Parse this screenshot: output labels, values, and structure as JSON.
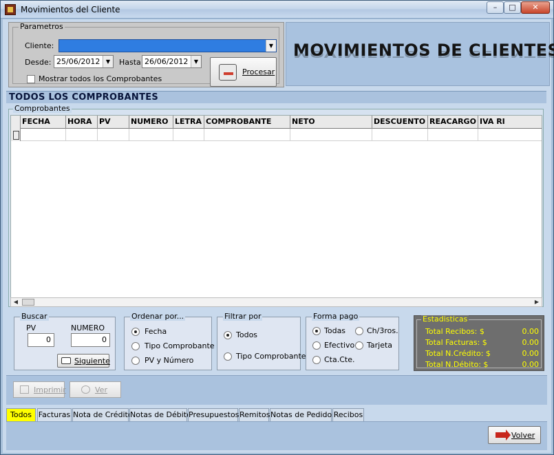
{
  "window": {
    "title": "Movimientos del Cliente",
    "buttons": {
      "minimize": "–",
      "maximize": "□",
      "close": "✕"
    }
  },
  "params": {
    "legend": "Parametros",
    "cliente_label": "Cliente:",
    "cliente_value": "",
    "desde_label": "Desde:",
    "desde_value": "25/06/2012",
    "hasta_label": "Hasta:",
    "hasta_value": "26/06/2012",
    "mostrar_todos_label": "Mostrar todos los Comprobantes",
    "mostrar_todos_checked": false,
    "procesar_label": "Procesar"
  },
  "banner": {
    "title": "MOVIMIENTOS DE CLIENTES"
  },
  "section": {
    "title": "TODOS LOS COMPROBANTES"
  },
  "comprobantes": {
    "legend": "Comprobantes",
    "columns": [
      "FECHA",
      "HORA",
      "PV",
      "NUMERO",
      "LETRA",
      "COMPROBANTE",
      "NETO",
      "DESCUENTO",
      "REACARGO",
      "IVA RI"
    ]
  },
  "buscar": {
    "legend": "Buscar",
    "pv_label": "PV",
    "pv_value": "0",
    "numero_label": "NUMERO",
    "numero_value": "0",
    "siguiente_label": "Siguiente"
  },
  "ordenar": {
    "legend": "Ordenar por...",
    "options": [
      "Fecha",
      "Tipo Comprobante",
      "PV y Número"
    ],
    "selected": "Fecha"
  },
  "filtrar": {
    "legend": "Filtrar por",
    "options": [
      "Todos",
      "Tipo Comprobante"
    ],
    "selected": "Todos"
  },
  "forma_pago": {
    "legend": "Forma pago",
    "options": [
      "Todas",
      "Ch/3ros.",
      "Efectivo",
      "Tarjeta",
      "Cta.Cte."
    ],
    "selected": "Todas"
  },
  "estadisticas": {
    "legend": "Estadisticas",
    "rows": [
      {
        "label": "Total Recibos: $",
        "value": "0.00"
      },
      {
        "label": "Total Facturas: $",
        "value": "0.00"
      },
      {
        "label": "Total N.Crédito: $",
        "value": "0.00"
      },
      {
        "label": "Total N.Débito: $",
        "value": "0.00"
      }
    ],
    "text_color": "#ffff00"
  },
  "actions": {
    "imprimir_label": "Imprimir",
    "ver_label": "Ver",
    "volver_label": "Volver"
  },
  "tabs": [
    {
      "label": "Todos",
      "active": true
    },
    {
      "label": "Facturas",
      "active": false
    },
    {
      "label": "Nota de Crédito",
      "active": false
    },
    {
      "label": "Notas de Débito",
      "active": false
    },
    {
      "label": "Presupuestos",
      "active": false
    },
    {
      "label": "Remitos",
      "active": false
    },
    {
      "label": "Notas de Pedidos",
      "active": false
    },
    {
      "label": "Recibos",
      "active": false
    }
  ]
}
